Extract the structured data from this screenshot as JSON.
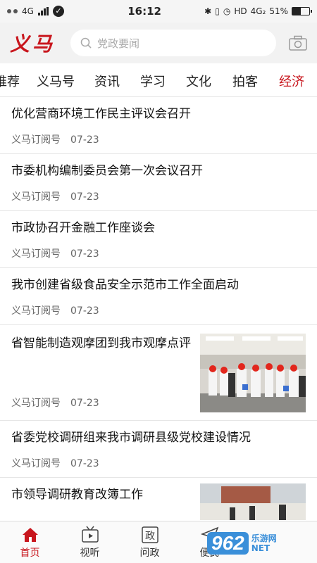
{
  "status_bar": {
    "network": "4G",
    "time": "16:12",
    "hd": "HD",
    "net2": "4G₂",
    "battery": "51%",
    "battery_level": 0.51
  },
  "header": {
    "logo": "义马",
    "search_placeholder": "党政要闻"
  },
  "tabs": [
    "推荐",
    "义马号",
    "资讯",
    "学习",
    "文化",
    "拍客",
    "经济"
  ],
  "active_tab": "经济",
  "news": [
    {
      "title": "优化营商环境工作民主评议会召开",
      "source": "义马订阅号",
      "date": "07-23"
    },
    {
      "title": "市委机构编制委员会第一次会议召开",
      "source": "义马订阅号",
      "date": "07-23"
    },
    {
      "title": "市政协召开金融工作座谈会",
      "source": "义马订阅号",
      "date": "07-23"
    },
    {
      "title": "我市创建省级食品安全示范市工作全面启动",
      "source": "义马订阅号",
      "date": "07-23"
    },
    {
      "title": "省智能制造观摩团到我市观摩点评",
      "source": "义马订阅号",
      "date": "07-23"
    },
    {
      "title": "省委党校调研组来我市调研县级党校建设情况",
      "source": "义马订阅号",
      "date": "07-23"
    },
    {
      "title": "市领导调研教育改簿工作",
      "source": "",
      "date": ""
    }
  ],
  "bottom_nav": [
    {
      "label": "首页",
      "icon": "home-icon"
    },
    {
      "label": "视听",
      "icon": "tv-icon"
    },
    {
      "label": "问政",
      "icon": "politics-icon"
    },
    {
      "label": "便民",
      "icon": "send-icon"
    }
  ],
  "watermark": {
    "number": "962",
    "line1": "乐游网",
    "line2": "NET"
  },
  "colors": {
    "accent": "#c8161d"
  }
}
